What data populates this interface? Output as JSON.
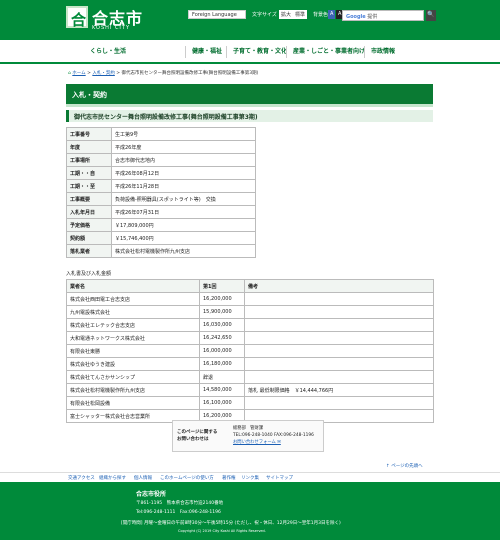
{
  "header": {
    "logo_char": "合",
    "site_name": "合志市",
    "site_sub": "KOSHI CITY",
    "lang_button": "Foreign Language",
    "text_size_label": "文字サイズ",
    "enlarge": "拡大",
    "standard": "標準",
    "bg_color_label": "背景色",
    "bg_a1": "A",
    "bg_a2": "A",
    "bg_standard": "標準",
    "search_brand": "Google",
    "search_placeholder": "提供",
    "search_button": "🔍"
  },
  "nav": [
    "くらし・生活",
    "健康・福祉",
    "子育て・教育・文化",
    "産業・しごと・事業者向け",
    "市政情報"
  ],
  "breadcrumb": {
    "home": "ホーム",
    "sep1": ">",
    "parent": "入札・契約",
    "sep2": ">",
    "current": "御代志市民センター舞台照明設備改修工事(舞台照明設備工事第3期)"
  },
  "section_title": "入札・契約",
  "page_title": "御代志市民センター舞台照明設備改修工事(舞台照明設備工事第3期)",
  "info_table": [
    {
      "label": "工事番号",
      "value": "生工第9号"
    },
    {
      "label": "年度",
      "value": "平成26年度"
    },
    {
      "label": "工事場所",
      "value": "合志市御代志地内"
    },
    {
      "label": "工期・・自",
      "value": "平成26年08月12日"
    },
    {
      "label": "工期・・至",
      "value": "平成26年11月28日"
    },
    {
      "label": "工事概要",
      "value": "負荷設備-照明器具(スポットライト等)　交換"
    },
    {
      "label": "入札年月日",
      "value": "平成26年07月31日"
    },
    {
      "label": "予定価格",
      "value": "￥17,809,000円"
    },
    {
      "label": "契約額",
      "value": "￥15,746,400円"
    },
    {
      "label": "落札業者",
      "value": "株式会社松村電機製作所九州支店"
    }
  ],
  "bid_title": "入札書及び入札金額",
  "bid_headers": [
    "業者名",
    "第1回",
    "備考"
  ],
  "bids": [
    {
      "name": "株式会社西田電工合志支店",
      "amount": "16,200,000",
      "note": ""
    },
    {
      "name": "九州電設株式会社",
      "amount": "15,900,000",
      "note": ""
    },
    {
      "name": "株式会社エレテック合志支店",
      "amount": "16,030,000",
      "note": ""
    },
    {
      "name": "大和電通ネットワークス株式会社",
      "amount": "16,242,650",
      "note": ""
    },
    {
      "name": "有限会社東勝",
      "amount": "16,000,000",
      "note": ""
    },
    {
      "name": "株式会社ゆうき建設",
      "amount": "16,180,000",
      "note": ""
    },
    {
      "name": "株式会社てんさかサンシップ",
      "amount": "辞退",
      "note": ""
    },
    {
      "name": "株式会社松村電機製作所九州支店",
      "amount": "14,580,000",
      "note": "落札 最低制限価格　￥14,444,766円"
    },
    {
      "name": "有限会社松岡設備",
      "amount": "16,100,000",
      "note": ""
    },
    {
      "name": "富士シャッター株式会社合志営業所",
      "amount": "16,200,000",
      "note": ""
    }
  ],
  "contact": {
    "label_line1": "このページに関する",
    "label_line2": "お問い合わせは",
    "dept": "総務部　管財課",
    "tel": "TEL:096-248-1040 FAX:096-248-1196",
    "form_link": "お問い合わせフォーム ✉"
  },
  "page_top": "ページの先頭へ",
  "footer_links": [
    "交通アクセス",
    "組織から探す",
    "個人情報",
    "このホームページの使い方",
    "著作権",
    "リンク集",
    "サイトマップ"
  ],
  "footer": {
    "office": "合志市役所",
    "address": "〒861-1195　熊本県合志市竹迫2140番地",
    "tel": "Tel:096-248-1111　Fax:096-248-1196",
    "hours": "[開庁時間] 月曜～金曜日の午前8時30分～午後5時15分 (ただし、祝・休日、12月29日～翌年1月3日を除く)",
    "copyright": "Copyright (C) 2019 City Koshi All Rights Reserved."
  }
}
